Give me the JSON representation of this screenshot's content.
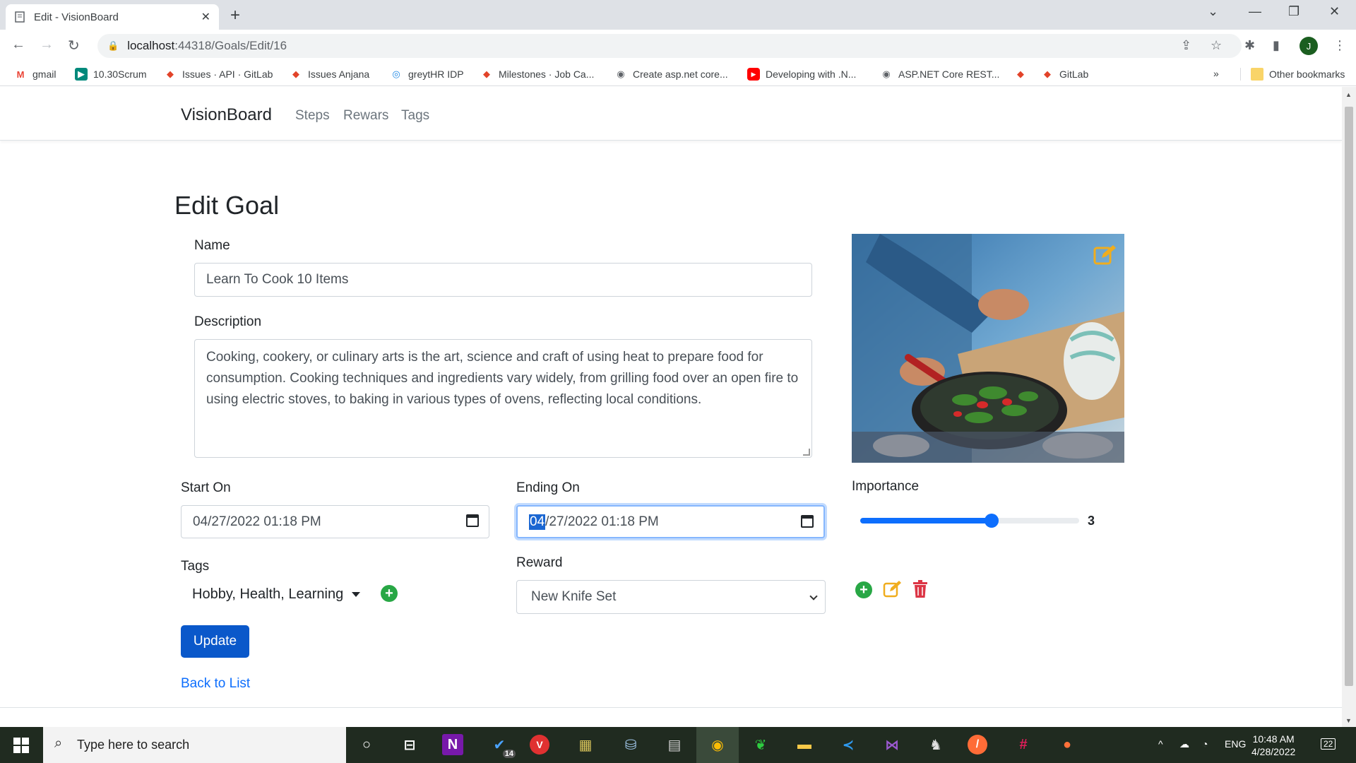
{
  "browser": {
    "tab_title": "Edit - VisionBoard",
    "url_host": "localhost",
    "url_path": ":44318/Goals/Edit/16",
    "profile_initial": "J",
    "bookmarks": [
      {
        "label": "gmail",
        "icon": "gmail-icon",
        "color": "#ea4335"
      },
      {
        "label": "10.30Scrum",
        "icon": "meet-icon",
        "color": "#00897b"
      },
      {
        "label": "Issues · API · GitLab",
        "icon": "gitlab-icon",
        "color": "#e24329"
      },
      {
        "label": "Issues Anjana",
        "icon": "gitlab-icon",
        "color": "#e24329"
      },
      {
        "label": "greytHR IDP",
        "icon": "greythr-icon",
        "color": "#1e88e5"
      },
      {
        "label": "Milestones · Job Ca...",
        "icon": "gitlab-icon",
        "color": "#e24329"
      },
      {
        "label": "Create asp.net core...",
        "icon": "globe-icon",
        "color": "#5f6368"
      },
      {
        "label": "Developing with .N...",
        "icon": "youtube-icon",
        "color": "#ff0000"
      },
      {
        "label": "ASP.NET Core REST...",
        "icon": "globe-icon",
        "color": "#5f6368"
      },
      {
        "label": "",
        "icon": "gitlab-icon",
        "color": "#e24329"
      },
      {
        "label": "GitLab",
        "icon": "gitlab-icon",
        "color": "#e24329"
      }
    ],
    "overflow": "»",
    "other_bookmarks": "Other bookmarks"
  },
  "app": {
    "brand": "VisionBoard",
    "nav": [
      "Steps",
      "Rewars",
      "Tags"
    ]
  },
  "form": {
    "heading": "Edit Goal",
    "name_label": "Name",
    "name_value": "Learn To Cook 10 Items",
    "description_label": "Description",
    "description_value": "Cooking, cookery, or culinary arts is the art, science and craft of using heat to prepare food for consumption. Cooking techniques and ingredients vary widely, from grilling food over an open fire to using electric stoves, to baking in various types of ovens, reflecting local conditions.",
    "start_label": "Start On",
    "start_value": "04/27/2022 01:18 PM",
    "end_label": "Ending On",
    "end_value_selected": "04",
    "end_value_rest": "/27/2022 01:18 PM",
    "importance_label": "Importance",
    "importance_value": "3",
    "importance_fraction": 0.6,
    "tags_label": "Tags",
    "tags_value": "Hobby, Health, Learning",
    "reward_label": "Reward",
    "reward_value": "New Knife Set",
    "update_button": "Update",
    "back_link": "Back to List"
  },
  "taskbar": {
    "search_placeholder": "Type here to search",
    "todo_badge": "14",
    "language": "ENG",
    "time": "10:48 AM",
    "date": "4/28/2022",
    "notification_count": "22"
  },
  "colors": {
    "primary": "#0d6efd",
    "success": "#28a745",
    "warning": "#f0ad1e",
    "danger": "#dc3545"
  }
}
